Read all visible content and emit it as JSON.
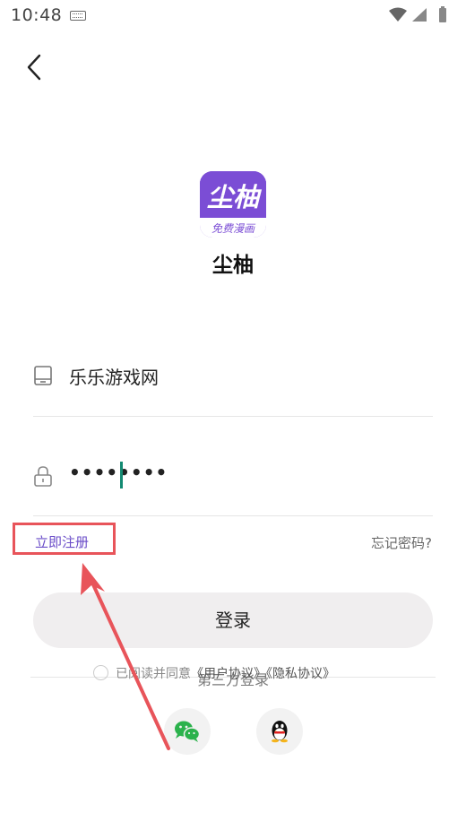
{
  "status_bar": {
    "time": "10:48",
    "icons": [
      "keyboard-icon",
      "wifi-icon",
      "signal-icon",
      "battery-icon"
    ]
  },
  "nav": {
    "back_icon": "chevron-left-icon"
  },
  "app": {
    "logo_main": "尘柚",
    "logo_sub": "免费漫画",
    "name": "尘柚",
    "brand_color": "#7b4dd5"
  },
  "form": {
    "account_value": "乐乐游戏网",
    "account_icon": "phone-icon",
    "password_value": "••••••••",
    "password_icon": "lock-icon",
    "caret_color": "#138a72"
  },
  "links": {
    "register": "立即注册",
    "forgot": "忘记密码?"
  },
  "login_button": "登录",
  "agreement": {
    "prefix": "已阅读并同意",
    "user_agreement": "《用户协议》",
    "privacy_policy": "《隐私协议》"
  },
  "third_party": {
    "title": "第三方登录",
    "providers": [
      "wechat-icon",
      "qq-icon"
    ]
  },
  "annotation": {
    "color": "#e8545a"
  }
}
